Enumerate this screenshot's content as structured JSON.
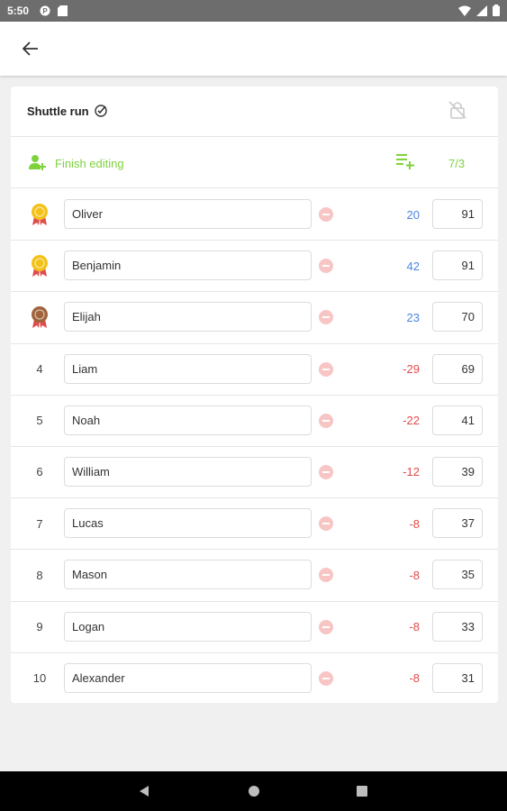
{
  "status_bar": {
    "time": "5:50"
  },
  "card": {
    "title": "Shuttle run",
    "finish_label": "Finish editing",
    "count": "7/3"
  },
  "rows": [
    {
      "rank": "",
      "medal": "gold",
      "name": "Oliver",
      "diff": "20",
      "score": "91"
    },
    {
      "rank": "",
      "medal": "gold",
      "name": "Benjamin",
      "diff": "42",
      "score": "91"
    },
    {
      "rank": "",
      "medal": "bronze",
      "name": "Elijah",
      "diff": "23",
      "score": "70"
    },
    {
      "rank": "4",
      "medal": "",
      "name": "Liam",
      "diff": "-29",
      "score": "69"
    },
    {
      "rank": "5",
      "medal": "",
      "name": "Noah",
      "diff": "-22",
      "score": "41"
    },
    {
      "rank": "6",
      "medal": "",
      "name": "William",
      "diff": "-12",
      "score": "39"
    },
    {
      "rank": "7",
      "medal": "",
      "name": "Lucas",
      "diff": "-8",
      "score": "37"
    },
    {
      "rank": "8",
      "medal": "",
      "name": "Mason",
      "diff": "-8",
      "score": "35"
    },
    {
      "rank": "9",
      "medal": "",
      "name": "Logan",
      "diff": "-8",
      "score": "33"
    },
    {
      "rank": "10",
      "medal": "",
      "name": "Alexander",
      "diff": "-8",
      "score": "31"
    }
  ],
  "colors": {
    "accent_green": "#7ed23c",
    "positive_blue": "#4a87e0",
    "negative_red": "#e44a4a",
    "gold": "#f2c21b",
    "bronze": "#a0633a"
  },
  "icons": {
    "back": "arrow-back-icon",
    "check": "check-circle-icon",
    "lock": "lock-off-icon",
    "user_add": "person-add-icon",
    "playlist_add": "playlist-add-icon",
    "medal": "medal-icon",
    "remove": "remove-circle-icon"
  }
}
